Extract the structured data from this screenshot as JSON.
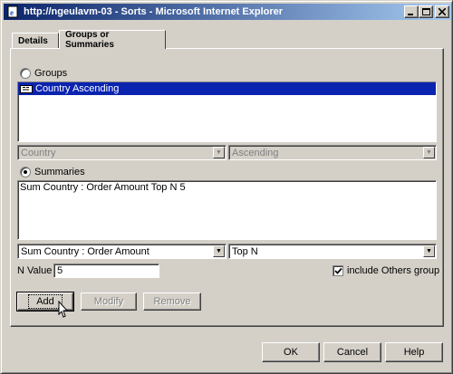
{
  "window": {
    "title": "http://ngeulavm-03 - Sorts - Microsoft Internet Explorer"
  },
  "tabs": [
    {
      "label": "Details"
    },
    {
      "label": "Groups or Summaries"
    }
  ],
  "groups": {
    "radio_label": "Groups",
    "items": [
      "Country Ascending"
    ],
    "field_select": "Country",
    "order_select": "Ascending"
  },
  "summaries": {
    "radio_label": "Summaries",
    "items": [
      "Sum Country : Order Amount Top N 5"
    ],
    "field_select": "Sum Country : Order Amount",
    "type_select": "Top N"
  },
  "n_value": {
    "label": "N Value",
    "value": "5"
  },
  "include_others": {
    "label": "include Others group",
    "checked": true
  },
  "buttons": {
    "add": "Add",
    "modify": "Modify",
    "remove": "Remove",
    "ok": "OK",
    "cancel": "Cancel",
    "help": "Help"
  },
  "icons": {
    "title": "ie-page-icon",
    "row": "sort-row-icon",
    "cursor": "mouse-pointer-icon"
  }
}
